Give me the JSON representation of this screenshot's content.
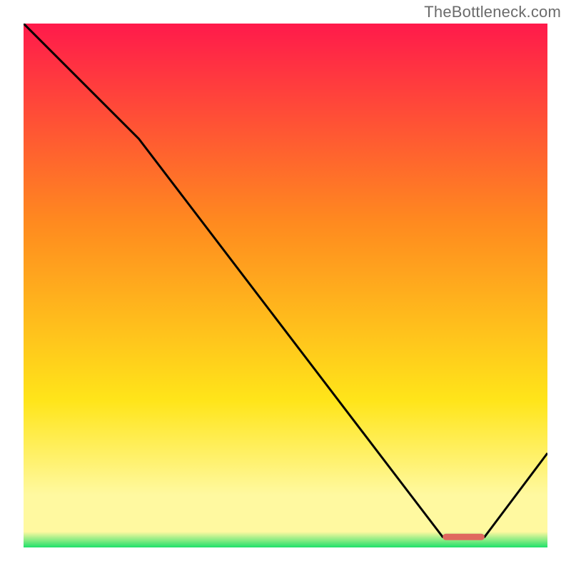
{
  "watermark": "TheBottleneck.com",
  "colors": {
    "gradient_top": "#ff1a4b",
    "gradient_mid1": "#ff8a1f",
    "gradient_mid2": "#ffe51a",
    "gradient_low": "#fff9a0",
    "gradient_base": "#1fe06a",
    "line": "#000000",
    "marker": "#e0685e"
  },
  "chart_data": {
    "type": "line",
    "title": "",
    "xlabel": "",
    "ylabel": "",
    "xlim": [
      0,
      100
    ],
    "ylim": [
      0,
      100
    ],
    "x": [
      0,
      22,
      80,
      88,
      100
    ],
    "values": [
      100,
      78,
      2,
      2,
      18
    ],
    "marker": {
      "x_start": 80,
      "x_end": 88,
      "y": 2
    },
    "note": "Values are percent of plot height/width estimated from gridless image; curve descends from top-left, flattens near x≈80–88 at the green band, then rises."
  }
}
